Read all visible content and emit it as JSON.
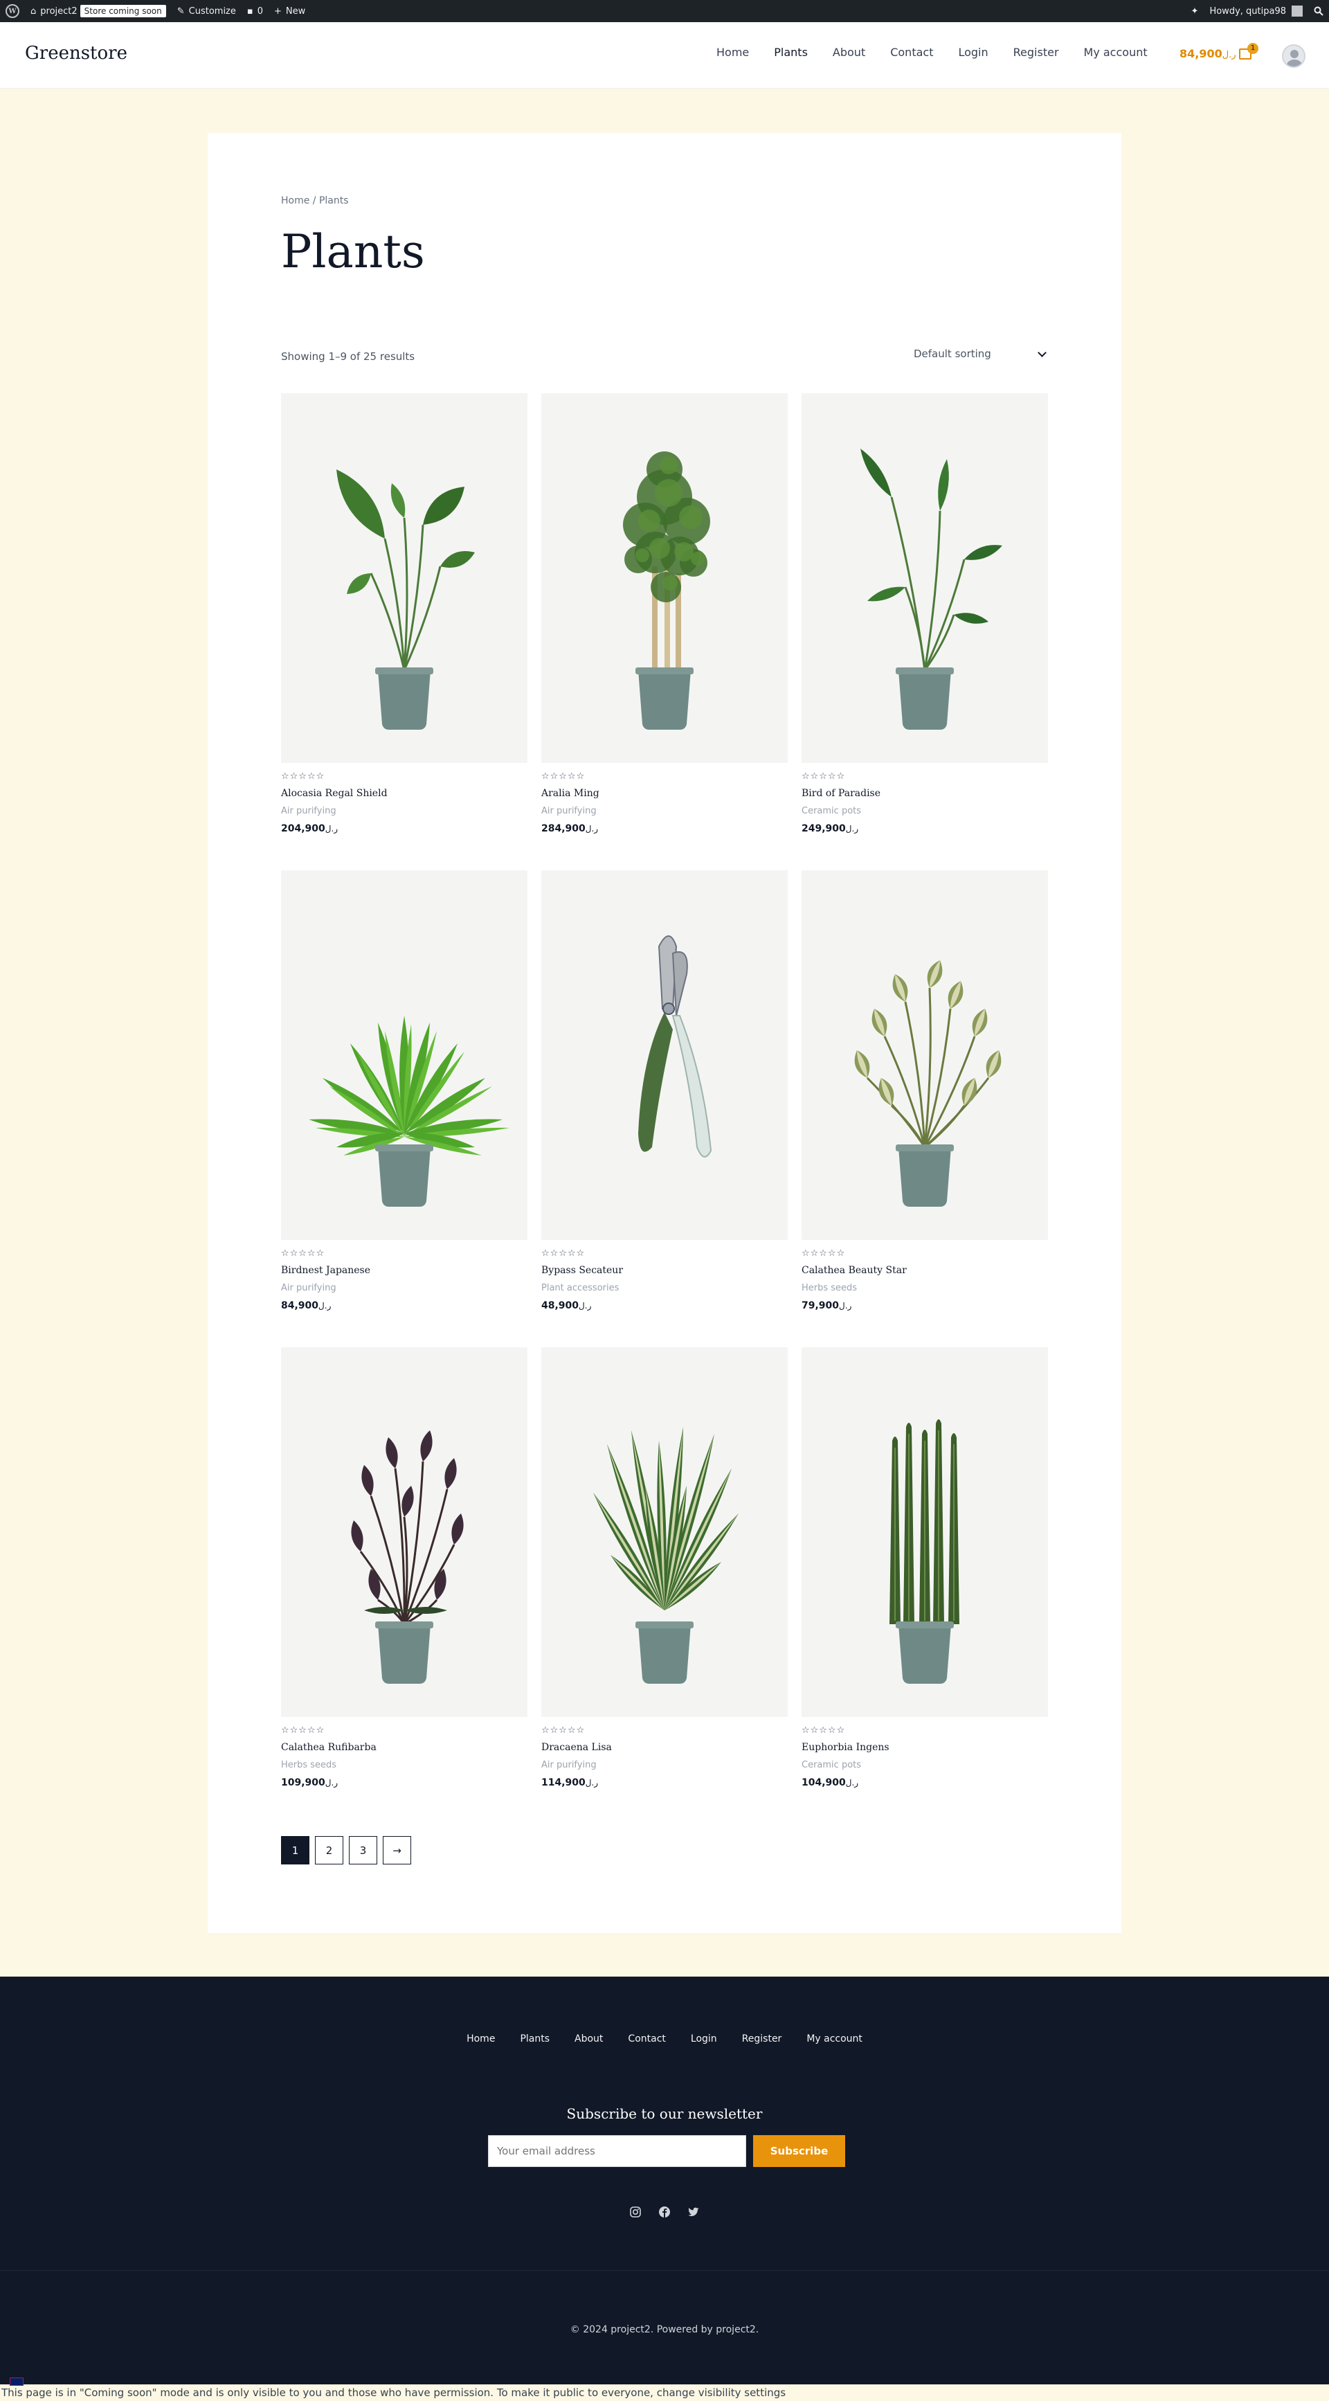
{
  "adminbar": {
    "site_name": "project2",
    "badge": "Store coming soon",
    "customize": "Customize",
    "comments": "0",
    "new": "New",
    "howdy": "Howdy, qutipa98"
  },
  "header": {
    "logo": "Greenstore",
    "nav": [
      "Home",
      "Plants",
      "About",
      "Contact",
      "Login",
      "Register",
      "My account"
    ],
    "cart_total": "84,900",
    "currency": "ر.ل",
    "cart_count": "1"
  },
  "breadcrumb": "Home / Plants",
  "page_title": "Plants",
  "result_count": "Showing 1–9 of 25 results",
  "sorting": "Default sorting",
  "stars": "☆☆☆☆☆",
  "products": [
    {
      "name": "Alocasia Regal Shield",
      "category": "Air purifying",
      "price": "204,900",
      "plant": "alocasia"
    },
    {
      "name": "Aralia Ming",
      "category": "Air purifying",
      "price": "284,900",
      "plant": "aralia"
    },
    {
      "name": "Bird of Paradise",
      "category": "Ceramic pots",
      "price": "249,900",
      "plant": "paradise"
    },
    {
      "name": "Birdnest Japanese",
      "category": "Air purifying",
      "price": "84,900",
      "plant": "fern"
    },
    {
      "name": "Bypass Secateur",
      "category": "Plant accessories",
      "price": "48,900",
      "plant": "secateur"
    },
    {
      "name": "Calathea Beauty Star",
      "category": "Herbs seeds",
      "price": "79,900",
      "plant": "calathea"
    },
    {
      "name": "Calathea Rufibarba",
      "category": "Herbs seeds",
      "price": "109,900",
      "plant": "rufibarba"
    },
    {
      "name": "Dracaena Lisa",
      "category": "Air purifying",
      "price": "114,900",
      "plant": "dracaena"
    },
    {
      "name": "Euphorbia Ingens",
      "category": "Ceramic pots",
      "price": "104,900",
      "plant": "euphorbia"
    }
  ],
  "pagination": [
    "1",
    "2",
    "3",
    "→"
  ],
  "footer": {
    "nav": [
      "Home",
      "Plants",
      "About",
      "Contact",
      "Login",
      "Register",
      "My account"
    ],
    "newsletter_title": "Subscribe to our newsletter",
    "email_placeholder": "Your email address",
    "subscribe": "Subscribe",
    "social": [
      "instagram-icon",
      "facebook-icon",
      "twitter-icon"
    ],
    "copyright": "© 2024 project2. Powered by project2."
  },
  "notice": {
    "text": "This page is in \"Coming soon\" mode and is only visible to you and those who have permission. To make it public to everyone, ",
    "link": "change visibility settings"
  },
  "colors": {
    "accent": "#e8930c",
    "dark": "#111827",
    "cream": "#fdf8e4",
    "pot": "#6f8a86"
  }
}
